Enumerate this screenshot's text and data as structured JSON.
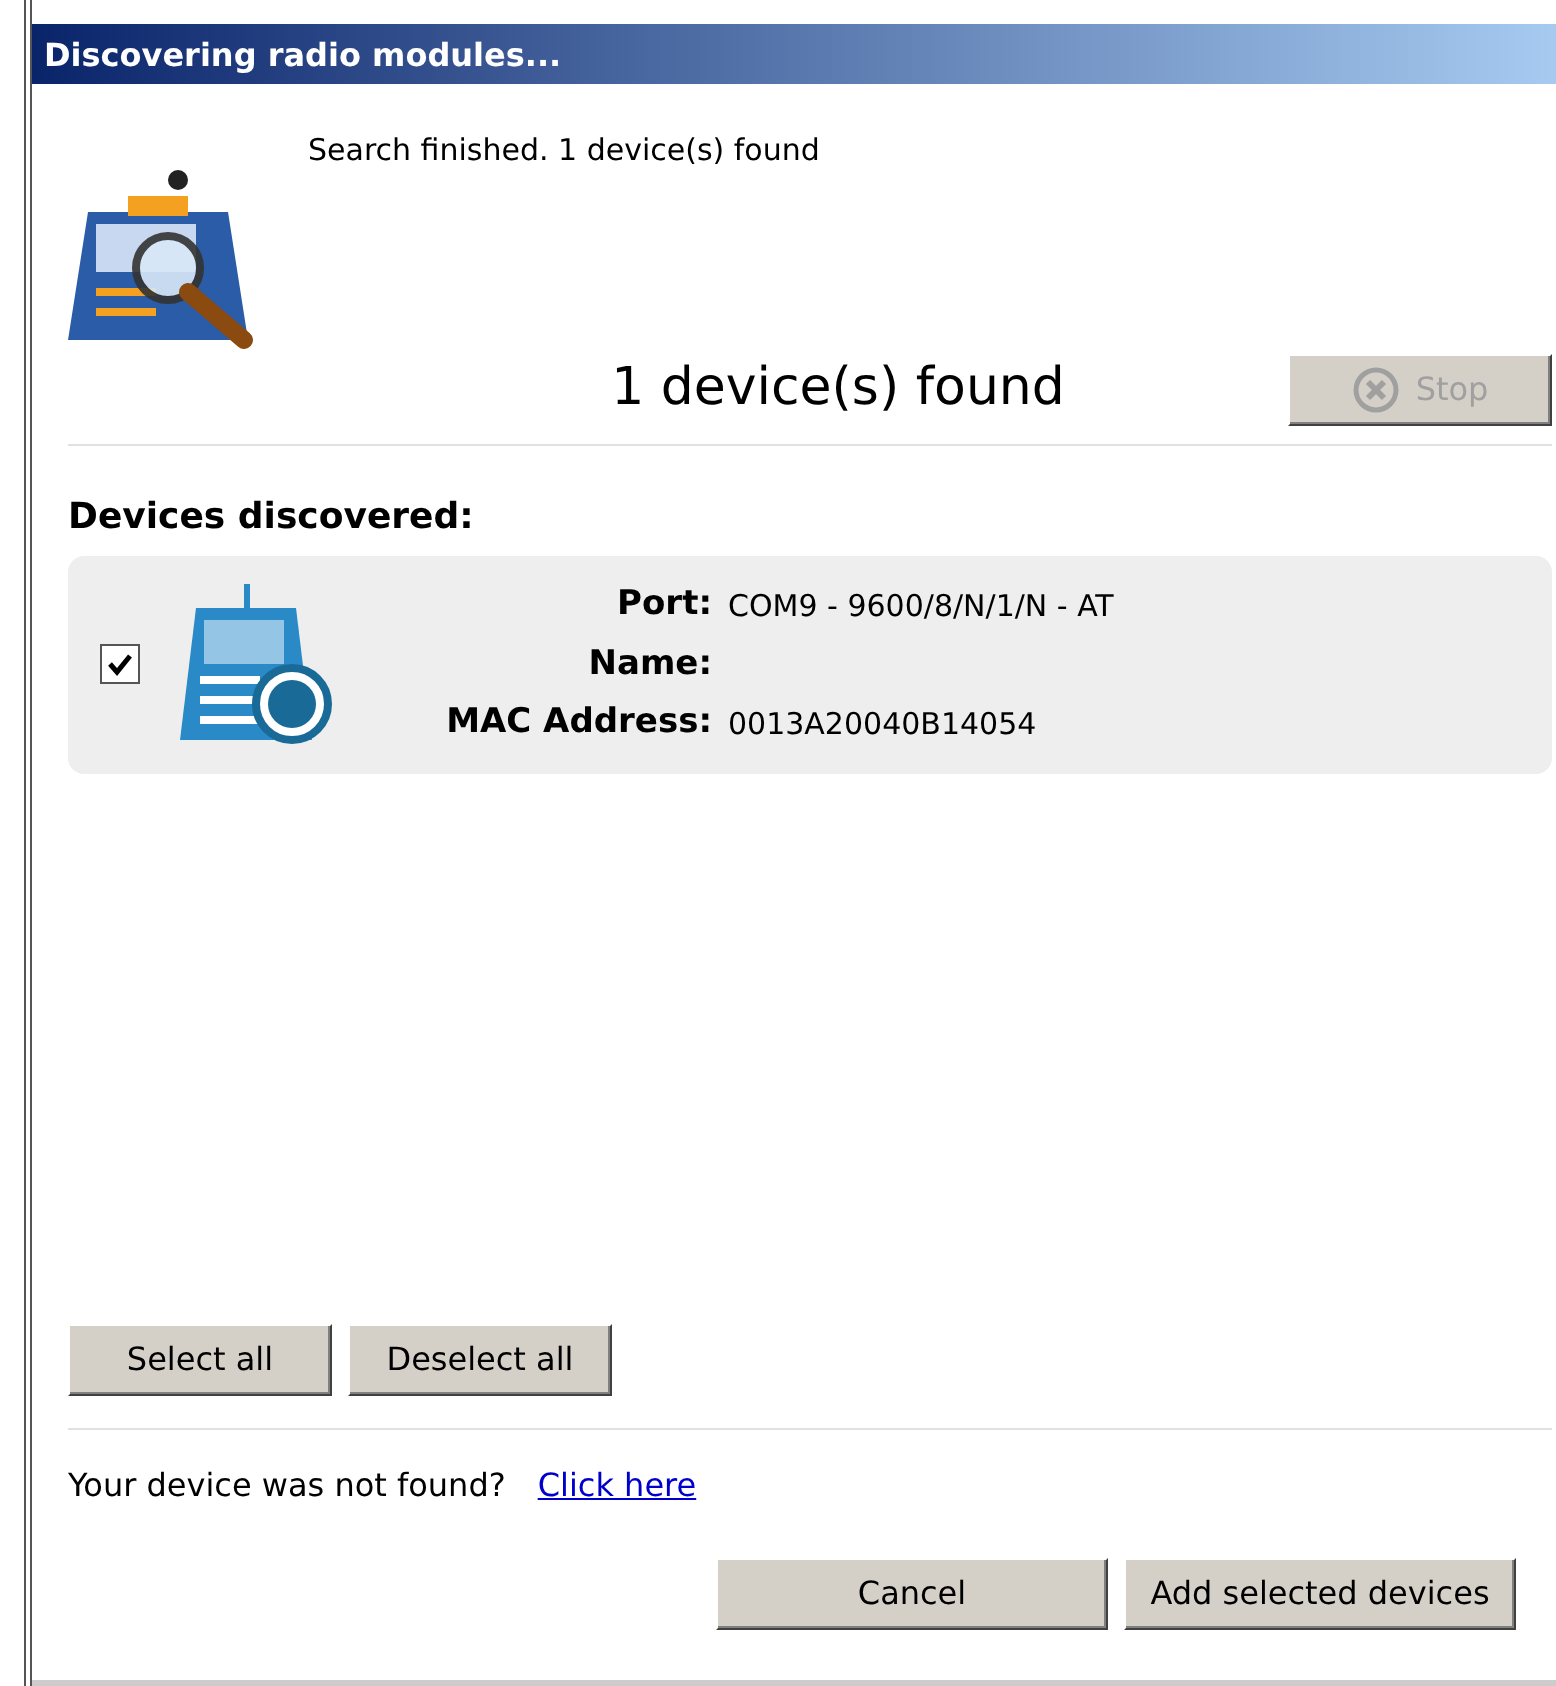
{
  "window": {
    "title": "Discovering radio modules..."
  },
  "status_message": "Search finished. 1 device(s) found",
  "found_count": "1 device(s) found",
  "stop_button": {
    "label": "Stop",
    "disabled": true
  },
  "devices_heading": "Devices discovered:",
  "devices": [
    {
      "checked": true,
      "fields": [
        {
          "label": "Port:",
          "value": "COM9 - 9600/8/N/1/N - AT"
        },
        {
          "label": "Name:"
        },
        {
          "label": "MAC Address:",
          "value": "0013A20040B14054"
        }
      ]
    }
  ],
  "select_buttons": [
    "Select all",
    "Deselect all"
  ],
  "not_found": {
    "text": "Your device was not found?",
    "link": "Click here"
  },
  "buttons": [
    "Cancel",
    "Add selected devices"
  ]
}
